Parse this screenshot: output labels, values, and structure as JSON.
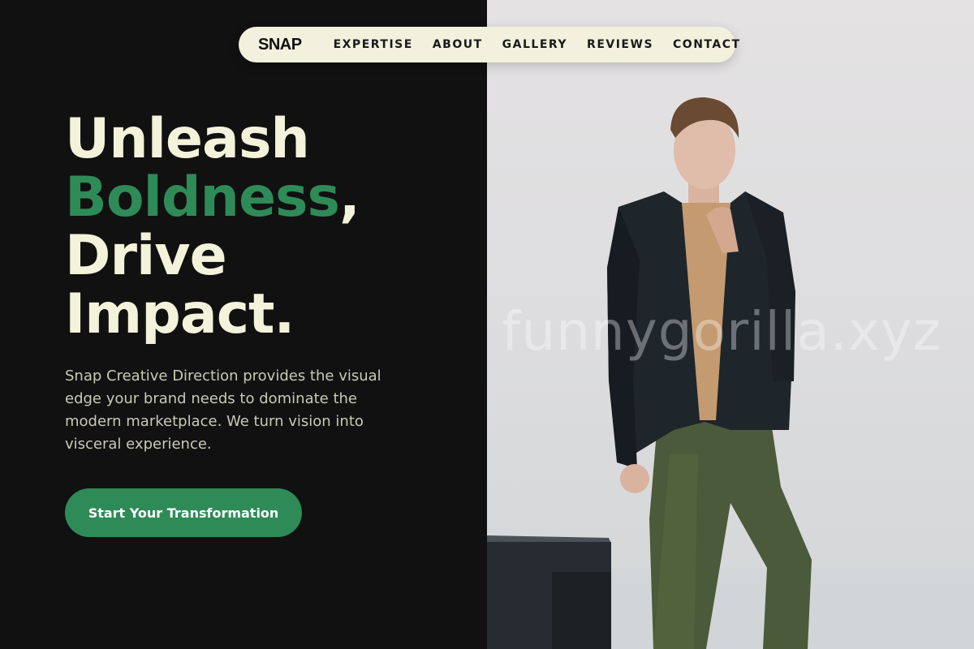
{
  "nav": {
    "logo": "SNAP",
    "items": [
      "EXPERTISE",
      "ABOUT",
      "GALLERY",
      "REVIEWS",
      "CONTACT"
    ]
  },
  "hero": {
    "headline_line1": "Unleash",
    "headline_accent": "Boldness",
    "headline_comma": ",",
    "headline_line3": "Drive",
    "headline_line4": "Impact.",
    "lead": "Snap Creative Direction provides the visual edge your brand needs to dominate the modern marketplace. We turn vision into visceral experience.",
    "cta_label": "Start Your Transformation"
  },
  "photo": {
    "watermark": "funnygorilla.xyz"
  },
  "colors": {
    "background": "#111111",
    "accent": "#2e8b57",
    "cream": "#f3f3dc",
    "nav_pill": "#f1f1de"
  }
}
